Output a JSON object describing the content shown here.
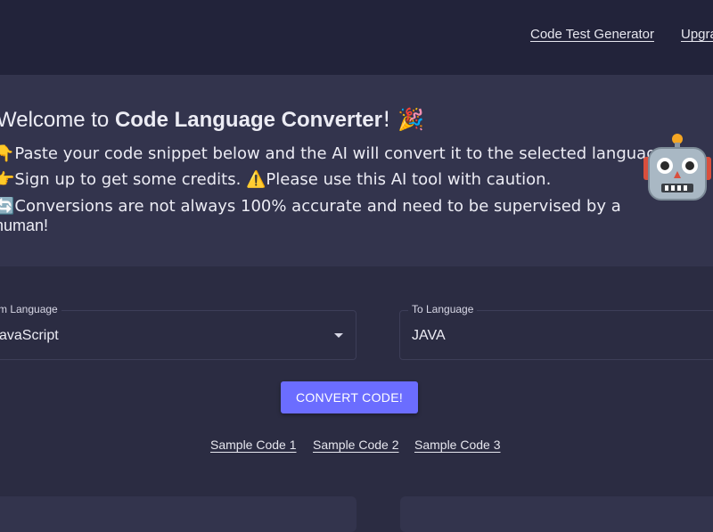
{
  "nav": {
    "links": [
      {
        "label": "Code Test Generator"
      },
      {
        "label": "Upgra"
      }
    ]
  },
  "hero": {
    "title_prefix": "Welcome to ",
    "title_bold": "Code Language Converter",
    "title_suffix": "! 🎉",
    "line1": "👇Paste your code snippet below and the AI will convert it to the selected language!",
    "line2": "👉Sign up to get some credits. ⚠️Please use this AI tool with caution.",
    "line3": "🔄Conversions are not always 100% accurate and need to be supervised by a",
    "line4": "human!",
    "icon": "robot-icon"
  },
  "converter": {
    "from_label": "From Language",
    "from_value": "JavaScript",
    "to_label": "To Language",
    "to_value": "JAVA",
    "convert_label": "CONVERT CODE!"
  },
  "samples": [
    {
      "label": "Sample Code 1"
    },
    {
      "label": "Sample Code 2"
    },
    {
      "label": "Sample Code 3"
    }
  ],
  "colors": {
    "page_bg": "#2b2c42",
    "topbar_bg": "#22233a",
    "hero_bg": "#33344d",
    "accent": "#6b6dff"
  }
}
